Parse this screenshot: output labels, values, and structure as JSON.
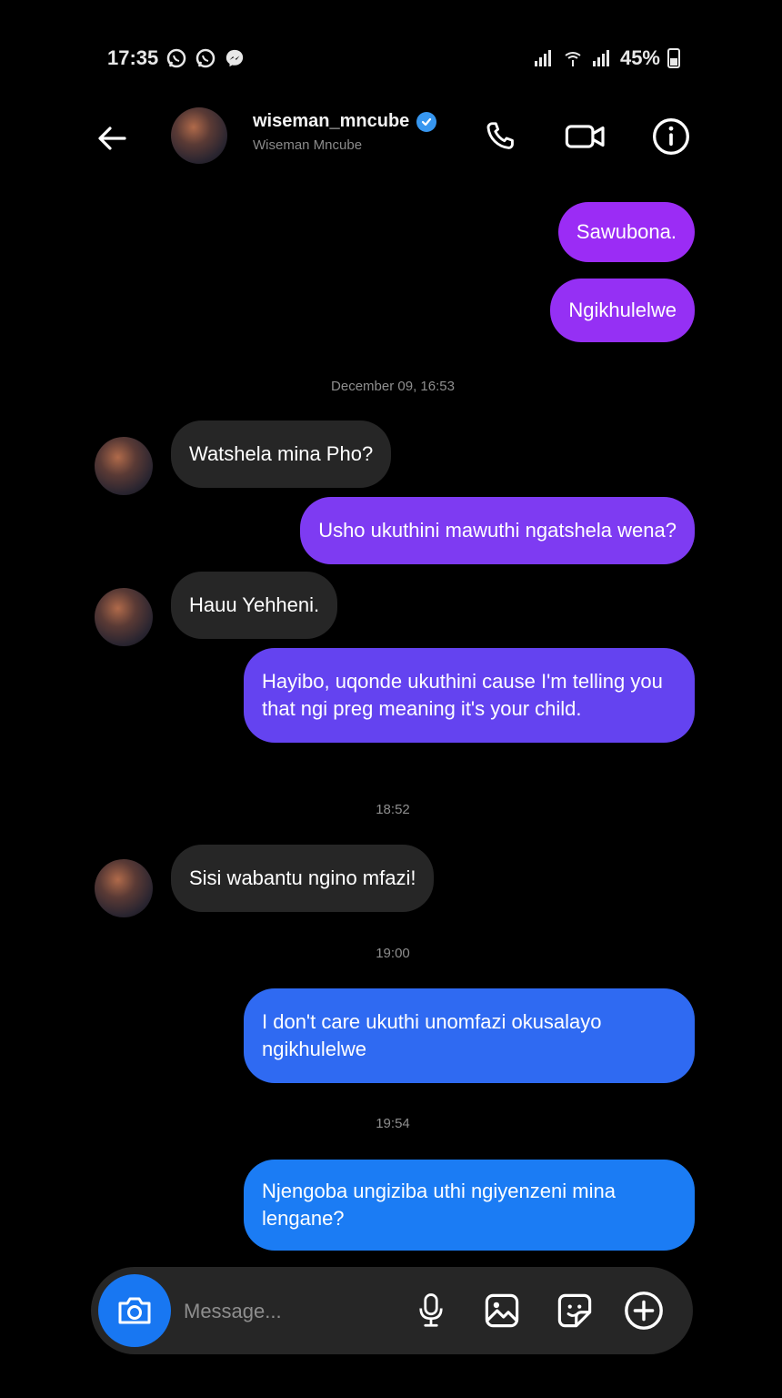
{
  "status_bar": {
    "time": "17:35",
    "battery": "45%",
    "left_icons": [
      "whatsapp-icon",
      "whatsapp-icon",
      "messenger-icon"
    ],
    "right_icons": [
      "signal-icon",
      "wifi-icon",
      "signal-icon",
      "battery-icon"
    ]
  },
  "header": {
    "username": "wiseman_mncube",
    "display_name": "Wiseman Mncube",
    "verified": true,
    "icons": [
      "back-arrow-icon",
      "phone-icon",
      "video-camera-icon",
      "info-icon"
    ]
  },
  "messages": [
    {
      "type": "out",
      "text": "Sawubona."
    },
    {
      "type": "out",
      "text": "Ngikhulelwe"
    },
    {
      "type": "timestamp",
      "text": "December 09, 16:53"
    },
    {
      "type": "in",
      "text": "Watshela mina Pho?"
    },
    {
      "type": "out",
      "text": "Usho ukuthini mawuthi ngatshela wena?"
    },
    {
      "type": "in",
      "text": "Hauu Yehheni."
    },
    {
      "type": "out",
      "text": "Hayibo, uqonde ukuthini cause I'm telling you that ngi preg meaning it's your child."
    },
    {
      "type": "timestamp",
      "text": "18:52"
    },
    {
      "type": "in",
      "text": "Sisi wabantu ngino mfazi!"
    },
    {
      "type": "timestamp",
      "text": "19:00"
    },
    {
      "type": "out",
      "text": "I don't care ukuthi unomfazi okusalayo ngikhulelwe"
    },
    {
      "type": "timestamp",
      "text": "19:54"
    },
    {
      "type": "out",
      "text": "Njengoba ungiziba uthi ngiyenzeni mina lengane?"
    }
  ],
  "composer": {
    "placeholder": "Message...",
    "icons": [
      "camera-icon",
      "microphone-icon",
      "gallery-icon",
      "sticker-icon",
      "add-icon"
    ]
  },
  "colors": {
    "background": "#000000",
    "incoming_bubble": "#262626",
    "outgoing_gradient": [
      "#9b2cf5",
      "#7a3cf0",
      "#5c4cf0",
      "#2f6af2",
      "#1b7cf4"
    ],
    "verified_badge": "#3797f0",
    "camera_button": "#1877f2"
  }
}
